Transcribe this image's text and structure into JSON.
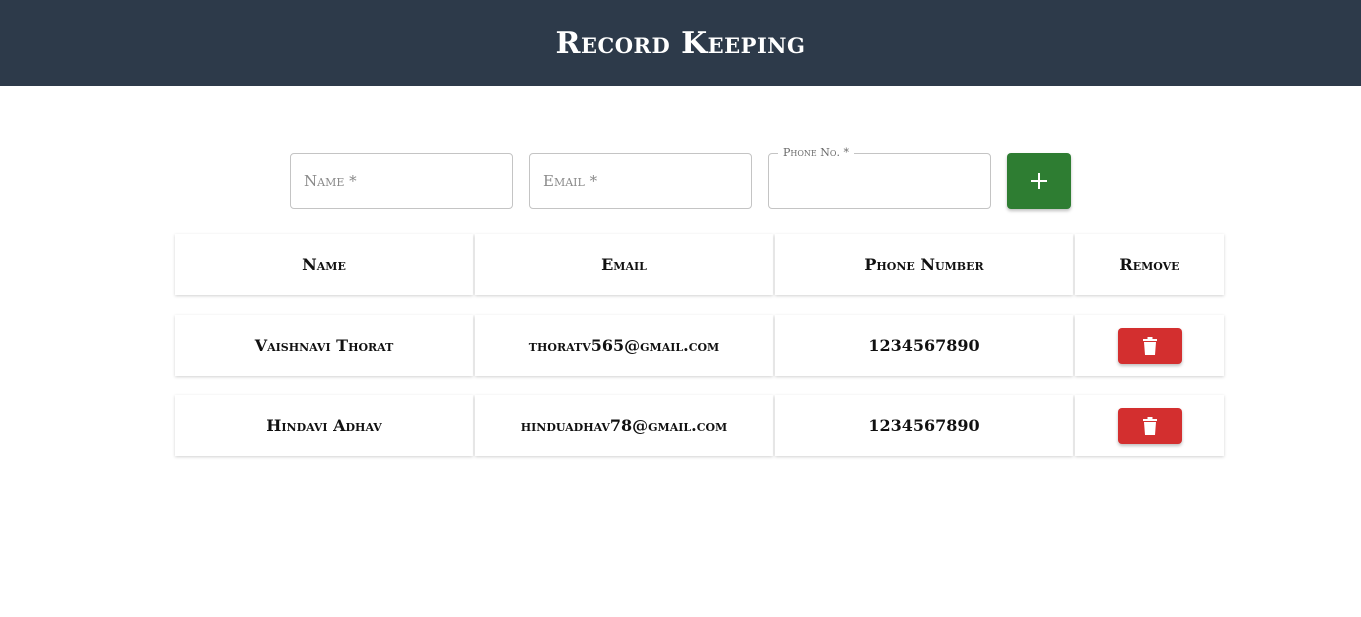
{
  "header": {
    "title": "Record Keeping"
  },
  "form": {
    "name_placeholder": "Name *",
    "email_placeholder": "Email *",
    "phone_label": "Phone No. *",
    "phone_value": ""
  },
  "table": {
    "headers": [
      "Name",
      "Email",
      "Phone Number",
      "Remove"
    ],
    "rows": [
      {
        "name": "Vaishnavi Thorat",
        "email": "thoratv565@gmail.com",
        "phone": "1234567890"
      },
      {
        "name": "Hindavi Adhav",
        "email": "hinduadhav78@gmail.com",
        "phone": "1234567890"
      }
    ]
  },
  "colors": {
    "header_bg": "#2d3a4a",
    "add_button": "#2e7d32",
    "delete_button": "#d32f2f"
  },
  "icons": {
    "add": "plus-icon",
    "remove": "trash-icon"
  }
}
